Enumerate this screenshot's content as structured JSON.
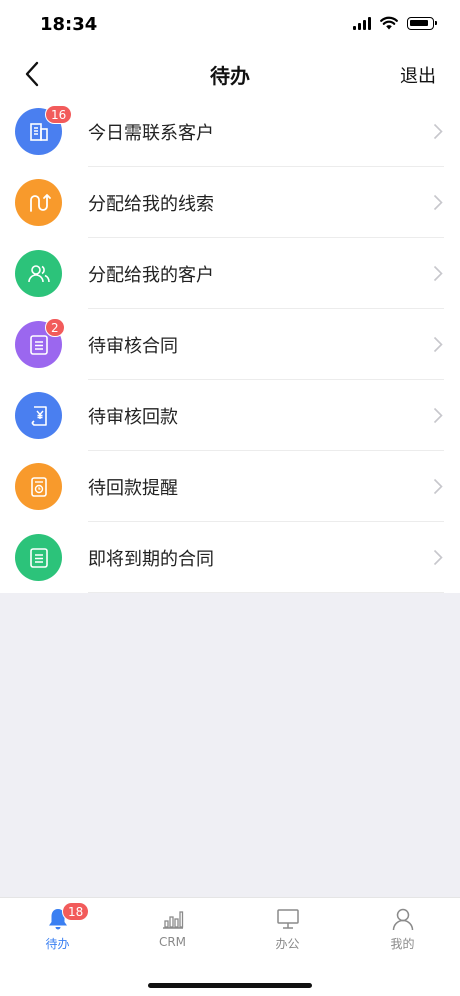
{
  "status_bar": {
    "time": "18:34",
    "icons": [
      "signal-icon",
      "wifi-icon",
      "battery-icon"
    ]
  },
  "nav": {
    "title": "待办",
    "back_icon": "chevron-left-icon",
    "logout_label": "退出"
  },
  "list": {
    "items": [
      {
        "label": "今日需联系客户",
        "badge": "16",
        "icon": "building-icon",
        "color": "#4a7ff0"
      },
      {
        "label": "分配给我的线索",
        "badge": "",
        "icon": "route-icon",
        "color": "#f89a2c"
      },
      {
        "label": "分配给我的客户",
        "badge": "",
        "icon": "users-icon",
        "color": "#2cc37a"
      },
      {
        "label": "待审核合同",
        "badge": "2",
        "icon": "document-icon",
        "color": "#9b67ef"
      },
      {
        "label": "待审核回款",
        "badge": "",
        "icon": "yen-document-icon",
        "color": "#4a7ff0"
      },
      {
        "label": "待回款提醒",
        "badge": "",
        "icon": "payment-clock-icon",
        "color": "#f89a2c"
      },
      {
        "label": "即将到期的合同",
        "badge": "",
        "icon": "document-icon",
        "color": "#2cc37a"
      }
    ]
  },
  "tab_bar": {
    "tabs": [
      {
        "label": "待办",
        "icon": "bell-icon",
        "badge": "18",
        "active": true
      },
      {
        "label": "CRM",
        "icon": "bar-chart-icon",
        "badge": "",
        "active": false
      },
      {
        "label": "办公",
        "icon": "monitor-icon",
        "badge": "",
        "active": false
      },
      {
        "label": "我的",
        "icon": "user-icon",
        "badge": "",
        "active": false
      }
    ]
  },
  "colors": {
    "accent": "#3a7ff2",
    "badge": "#f25b5b",
    "inactive": "#8a8a8a"
  }
}
